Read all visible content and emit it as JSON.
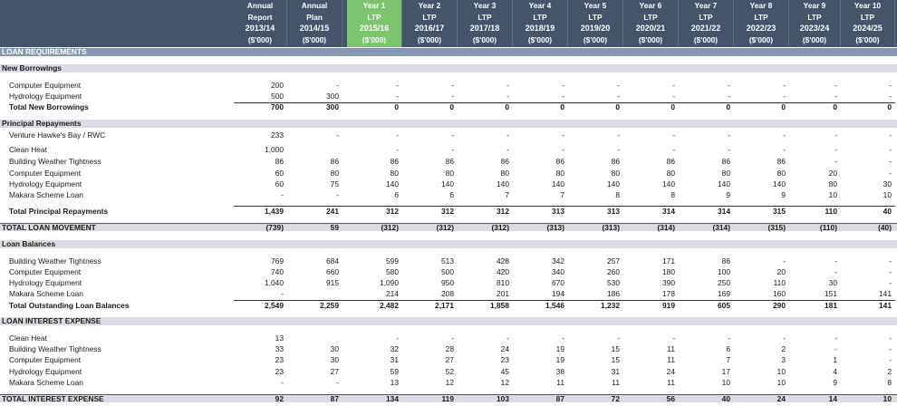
{
  "header": {
    "columns": [
      {
        "line1": "Annual",
        "line2": "Report",
        "line3": "2013/14",
        "line4": "($'000)"
      },
      {
        "line1": "Annual",
        "line2": "Plan",
        "line3": "2014/15",
        "line4": "($'000)"
      },
      {
        "line1": "Year 1",
        "line2": "LTP",
        "line3": "2015/16",
        "line4": "($'000)"
      },
      {
        "line1": "Year 2",
        "line2": "LTP",
        "line3": "2016/17",
        "line4": "($'000)"
      },
      {
        "line1": "Year 3",
        "line2": "LTP",
        "line3": "2017/18",
        "line4": "($'000)"
      },
      {
        "line1": "Year 4",
        "line2": "LTP",
        "line3": "2018/19",
        "line4": "($'000)"
      },
      {
        "line1": "Year 5",
        "line2": "LTP",
        "line3": "2019/20",
        "line4": "($'000)"
      },
      {
        "line1": "Year 6",
        "line2": "LTP",
        "line3": "2020/21",
        "line4": "($'000)"
      },
      {
        "line1": "Year 7",
        "line2": "LTP",
        "line3": "2021/22",
        "line4": "($'000)"
      },
      {
        "line1": "Year 8",
        "line2": "LTP",
        "line3": "2022/23",
        "line4": "($'000)"
      },
      {
        "line1": "Year 9",
        "line2": "LTP",
        "line3": "2023/24",
        "line4": "($'000)"
      },
      {
        "line1": "Year 10",
        "line2": "LTP",
        "line3": "2024/25",
        "line4": "($'000)"
      }
    ],
    "highlight_color": "#7dc56c",
    "header_color": "#44546a"
  },
  "sections": {
    "loan_requirements": {
      "title": "LOAN REQUIREMENTS"
    },
    "new_borrowings": {
      "title": "New Borrowings",
      "rows": [
        {
          "label": "Computer Equipment",
          "values": [
            "200",
            "-",
            "-",
            "-",
            "-",
            "-",
            "-",
            "-",
            "-",
            "-",
            "-",
            "-"
          ]
        },
        {
          "label": "Hydrology Equipment",
          "values": [
            "500",
            "300",
            "-",
            "-",
            "-",
            "-",
            "-",
            "-",
            "-",
            "-",
            "-",
            "-"
          ]
        }
      ],
      "total": {
        "label": "Total New Borrowings",
        "values": [
          "700",
          "300",
          "0",
          "0",
          "0",
          "0",
          "0",
          "0",
          "0",
          "0",
          "0",
          "0"
        ]
      }
    },
    "principal_repayments": {
      "title": "Principal Repayments",
      "rows": [
        {
          "label": "Venture Hawke's Bay / RWC",
          "values": [
            "233",
            "-",
            "-",
            "-",
            "-",
            "-",
            "-",
            "-",
            "-",
            "-",
            "-",
            "-"
          ]
        },
        {
          "label": "Clean Heat",
          "values": [
            "1,000",
            "",
            "-",
            "-",
            "-",
            "-",
            "-",
            "-",
            "-",
            "-",
            "-",
            "-"
          ]
        },
        {
          "label": "Building Weather Tightness",
          "values": [
            "86",
            "86",
            "86",
            "86",
            "86",
            "86",
            "86",
            "86",
            "86",
            "86",
            "-",
            "-"
          ]
        },
        {
          "label": "Computer Equipment",
          "values": [
            "60",
            "80",
            "80",
            "80",
            "80",
            "80",
            "80",
            "80",
            "80",
            "80",
            "20",
            "-"
          ]
        },
        {
          "label": "Hydrology Equipment",
          "values": [
            "60",
            "75",
            "140",
            "140",
            "140",
            "140",
            "140",
            "140",
            "140",
            "140",
            "80",
            "30"
          ]
        },
        {
          "label": "Makara Scheme Loan",
          "values": [
            "-",
            "-",
            "6",
            "6",
            "7",
            "7",
            "8",
            "8",
            "9",
            "9",
            "10",
            "10"
          ]
        }
      ],
      "total": {
        "label": "Total Principal Repayments",
        "values": [
          "1,439",
          "241",
          "312",
          "312",
          "312",
          "313",
          "313",
          "314",
          "314",
          "315",
          "110",
          "40"
        ]
      }
    },
    "total_loan_movement": {
      "label": "TOTAL LOAN MOVEMENT",
      "values": [
        "(739)",
        "59",
        "(312)",
        "(312)",
        "(312)",
        "(313)",
        "(313)",
        "(314)",
        "(314)",
        "(315)",
        "(110)",
        "(40)"
      ]
    },
    "loan_balances": {
      "title": "Loan Balances",
      "rows": [
        {
          "label": "Building Weather Tightness",
          "values": [
            "769",
            "684",
            "599",
            "513",
            "428",
            "342",
            "257",
            "171",
            "86",
            "-",
            "-",
            "-"
          ]
        },
        {
          "label": "Computer Equipment",
          "values": [
            "740",
            "660",
            "580",
            "500",
            "420",
            "340",
            "260",
            "180",
            "100",
            "20",
            "-",
            "-"
          ]
        },
        {
          "label": "Hydrology Equipment",
          "values": [
            "1,040",
            "915",
            "1,090",
            "950",
            "810",
            "670",
            "530",
            "390",
            "250",
            "110",
            "30",
            "-"
          ]
        },
        {
          "label": "Makara Scheme Loan",
          "values": [
            "-",
            "",
            "214",
            "208",
            "201",
            "194",
            "186",
            "178",
            "169",
            "160",
            "151",
            "141"
          ]
        }
      ],
      "total": {
        "label": "Total Outstanding Loan Balances",
        "values": [
          "2,549",
          "2,259",
          "2,482",
          "2,171",
          "1,858",
          "1,546",
          "1,232",
          "919",
          "605",
          "290",
          "181",
          "141"
        ]
      }
    },
    "loan_interest_expense": {
      "title": "LOAN INTEREST EXPENSE",
      "rows": [
        {
          "label": "Clean Heat",
          "values": [
            "13",
            "",
            "-",
            "-",
            "-",
            "-",
            "-",
            "-",
            "-",
            "-",
            "-",
            "-"
          ]
        },
        {
          "label": "Building Weather Tightness",
          "values": [
            "33",
            "30",
            "32",
            "28",
            "24",
            "19",
            "15",
            "11",
            "6",
            "2",
            "-",
            "-"
          ]
        },
        {
          "label": "Computer Equipment",
          "values": [
            "23",
            "30",
            "31",
            "27",
            "23",
            "19",
            "15",
            "11",
            "7",
            "3",
            "1",
            "-"
          ]
        },
        {
          "label": "Hydrology Equipment",
          "values": [
            "23",
            "27",
            "59",
            "52",
            "45",
            "38",
            "31",
            "24",
            "17",
            "10",
            "4",
            "2"
          ]
        },
        {
          "label": "Makara Scheme Loan",
          "values": [
            "-",
            "-",
            "13",
            "12",
            "12",
            "11",
            "11",
            "11",
            "10",
            "10",
            "9",
            "8"
          ]
        }
      ]
    },
    "total_interest_expense": {
      "label": "TOTAL INTEREST EXPENSE",
      "values": [
        "92",
        "87",
        "134",
        "119",
        "103",
        "87",
        "72",
        "56",
        "40",
        "24",
        "14",
        "10"
      ]
    }
  }
}
